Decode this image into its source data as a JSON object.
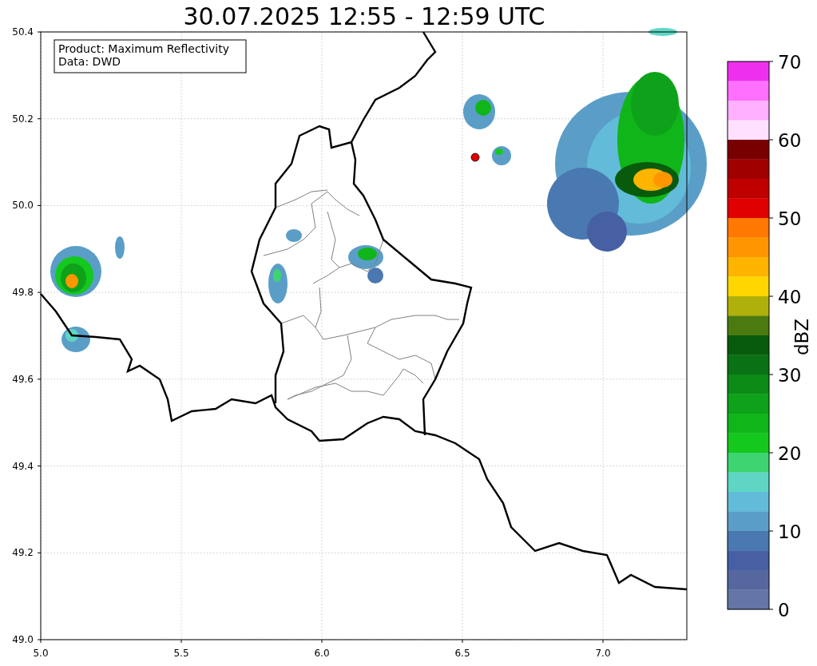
{
  "title": "30.07.2025 12:55 - 12:59 UTC",
  "info_box": [
    "Product: Maximum Reflectivity",
    "Data: DWD"
  ],
  "map": {
    "xticks": [
      "5.0",
      "5.5",
      "6.0",
      "6.5",
      "7.0"
    ],
    "yticks": [
      "50.4",
      "50.2",
      "50.0",
      "49.8",
      "49.6",
      "49.4",
      "49.2",
      "49.0"
    ]
  },
  "colorbar": {
    "label": "dBZ",
    "ticks": [
      "70",
      "60",
      "50",
      "40",
      "30",
      "20",
      "10",
      "0"
    ],
    "bands": [
      {
        "color": "#ee30ee"
      },
      {
        "color": "#ff70ff"
      },
      {
        "color": "#ffb0ff"
      },
      {
        "color": "#ffe0ff"
      },
      {
        "color": "#780000"
      },
      {
        "color": "#a00000"
      },
      {
        "color": "#c00000"
      },
      {
        "color": "#e00000"
      },
      {
        "color": "#ff7800"
      },
      {
        "color": "#ff9600"
      },
      {
        "color": "#ffb400"
      },
      {
        "color": "#ffd700"
      },
      {
        "color": "#b0b00a"
      },
      {
        "color": "#4a7a10"
      },
      {
        "color": "#085a0c"
      },
      {
        "color": "#0a7214"
      },
      {
        "color": "#0c8a16"
      },
      {
        "color": "#0ea11a"
      },
      {
        "color": "#10b51a"
      },
      {
        "color": "#14c81e"
      },
      {
        "color": "#3fd472"
      },
      {
        "color": "#5fd6c4"
      },
      {
        "color": "#62bcd9"
      },
      {
        "color": "#5a9ec8"
      },
      {
        "color": "#4a78b0"
      },
      {
        "color": "#4660a3"
      },
      {
        "color": "#5667a0"
      },
      {
        "color": "#6475a6"
      }
    ]
  }
}
